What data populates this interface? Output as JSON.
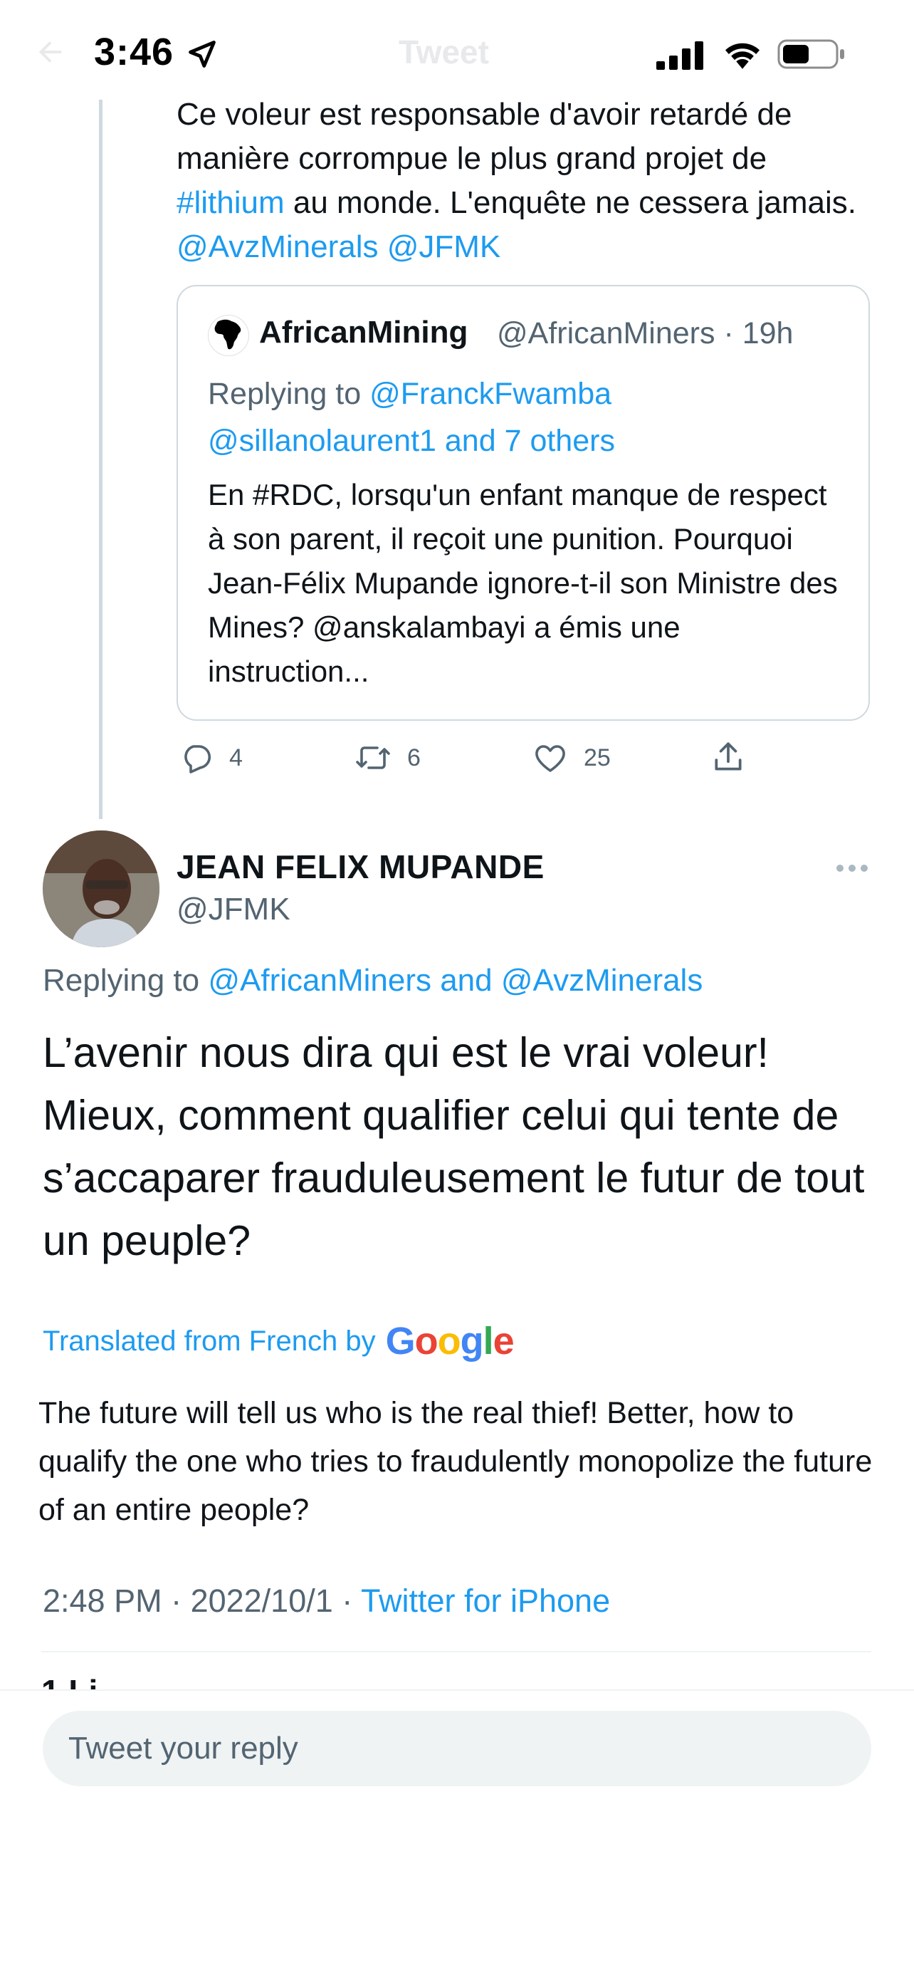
{
  "status_bar": {
    "time": "3:46",
    "title": "Tweet"
  },
  "parent_tweet": {
    "text_parts": [
      "Ce voleur est responsable d'avoir retardé de manière corrompue le plus grand projet de ",
      "#lithium",
      " au monde. L'enquête ne cessera jamais. ",
      "@AvzMinerals",
      " ",
      "@JFMK"
    ],
    "quote": {
      "name": "AfricanMining",
      "handle_time": "@AfricanMiners · 19h",
      "replying_prefix": "Replying to ",
      "replying_mention1": "@FranckFwamba",
      "replying_mention2": "@sillanolaurent1 and 7 others",
      "text": "En #RDC, lorsqu'un enfant manque de respect à son parent, il reçoit une punition. Pourquoi Jean-Félix Mupande ignore-t-il son Ministre des Mines? @anskalambayi a émis une instruction..."
    },
    "actions": {
      "replies": "4",
      "retweets": "6",
      "likes": "25"
    }
  },
  "main_tweet": {
    "name": "JEAN FELIX MUPANDE",
    "handle": "@JFMK",
    "replying_prefix": "Replying to ",
    "replying_to": "@AfricanMiners and @AvzMinerals",
    "text": "L’avenir nous dira qui est le vrai voleur! Mieux, comment qualifier celui qui tente de s’accaparer frauduleusement le futur de tout un peuple?",
    "translated_label": "Translated from French by",
    "translation_provider": "Google",
    "translation": "The future will tell us who is the real thief! Better, how to qualify the one who tries to fraudulently monopolize the future of an entire people?",
    "timestamp": "2:48 PM · 2022/10/1 · ",
    "source": "Twitter for iPhone",
    "likes_peek": "1 Li"
  },
  "composer": {
    "placeholder": "Tweet your reply"
  },
  "tabs": [
    "home",
    "search",
    "spaces",
    "notifications",
    "messages"
  ],
  "colors": {
    "link": "#1d9bf0",
    "secondary_text": "#536471",
    "primary_text": "#0f1419",
    "border": "#cfd9de"
  }
}
